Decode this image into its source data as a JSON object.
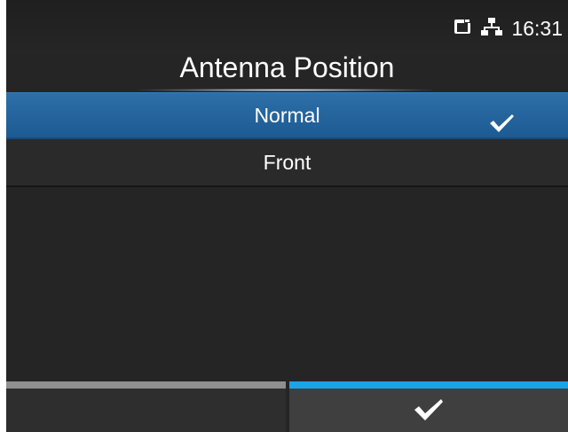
{
  "status": {
    "time": "16:31",
    "icons": [
      "memory-card-icon",
      "network-icon"
    ]
  },
  "title": "Antenna Position",
  "options": [
    {
      "label": "Normal",
      "selected": true
    },
    {
      "label": "Front",
      "selected": false
    }
  ],
  "footer": {
    "left_label": "",
    "right_icon": "check-icon"
  },
  "colors": {
    "background": "#252525",
    "selected_row": "#2465a0",
    "accent": "#1aa4e8",
    "left_bar": "#8f8f8f"
  }
}
